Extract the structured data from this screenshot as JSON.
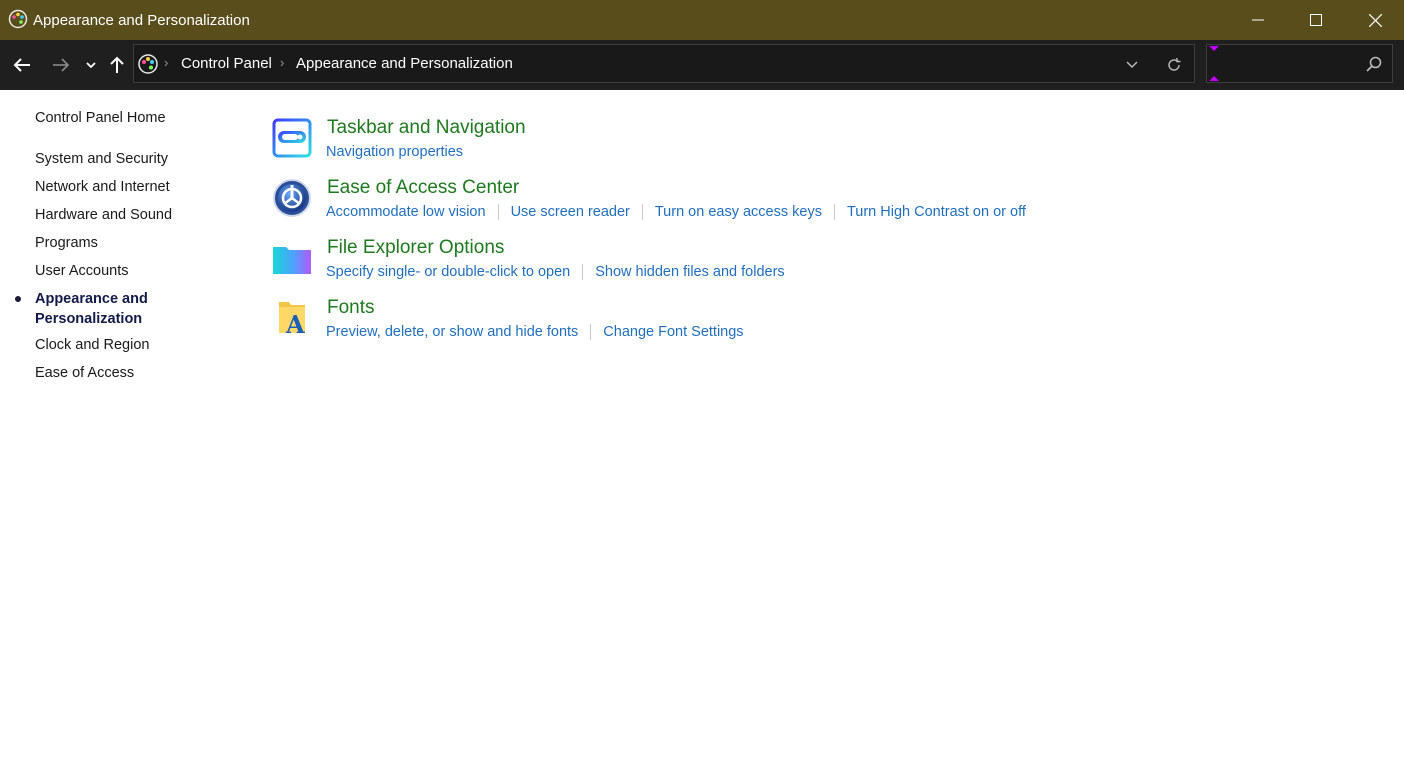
{
  "window": {
    "title": "Appearance and Personalization",
    "accent_color": "#5a4d1c"
  },
  "address": {
    "breadcrumbs": [
      "Control Panel",
      "Appearance and Personalization"
    ],
    "search_value": ""
  },
  "sidebar": {
    "home": "Control Panel Home",
    "items": [
      "System and Security",
      "Network and Internet",
      "Hardware and Sound",
      "Programs",
      "User Accounts",
      "Appearance and Personalization",
      "Clock and Region",
      "Ease of Access"
    ],
    "current_index": 5
  },
  "sections": [
    {
      "icon": "taskbar-icon",
      "title": "Taskbar and Navigation",
      "links": [
        "Navigation properties"
      ]
    },
    {
      "icon": "ease-of-access-icon",
      "title": "Ease of Access Center",
      "links": [
        "Accommodate low vision",
        "Use screen reader",
        "Turn on easy access keys",
        "Turn High Contrast on or off"
      ]
    },
    {
      "icon": "folder-icon",
      "title": "File Explorer Options",
      "links": [
        "Specify single- or double-click to open",
        "Show hidden files and folders"
      ]
    },
    {
      "icon": "fonts-icon",
      "title": "Fonts",
      "links": [
        "Preview, delete, or show and hide fonts",
        "Change Font Settings"
      ]
    }
  ],
  "colors": {
    "heading": "#1e7a1e",
    "link": "#1f6fbf",
    "nav_bg": "#1f1f1f"
  }
}
